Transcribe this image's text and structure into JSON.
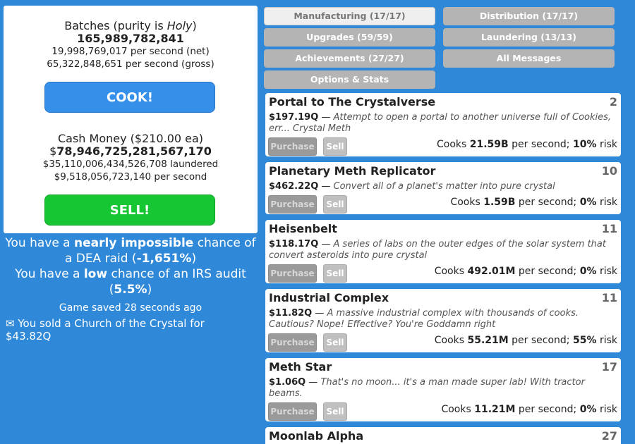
{
  "stats": {
    "batches_title_prefix": "Batches (purity is ",
    "batches_purity": "Holy",
    "batches_title_suffix": ")",
    "batches_value": "165,989,782,841",
    "batches_net": "19,998,769,017 per second (net)",
    "batches_gross": "65,322,848,651 per second (gross)",
    "cook_label": "COOK!",
    "cash_title": "Cash Money ($210.00 ea)",
    "cash_symbol": "$",
    "cash_value": "78,946,725,281,567,170",
    "cash_laundered": "$35,110,006,434,526,708 laundered",
    "cash_rate": "$9,518,056,723,140 per second",
    "sell_label": "SELL!"
  },
  "risk": {
    "dea_prefix": "You have a ",
    "dea_level": "nearly impossible",
    "dea_mid": " chance of a DEA raid (",
    "dea_value": "-1,651%",
    "dea_suffix": ")",
    "irs_prefix": "You have a ",
    "irs_level": "low",
    "irs_mid": " chance of an IRS audit (",
    "irs_value": "5.5%",
    "irs_suffix": ")"
  },
  "saved": "Game saved 28 seconds ago",
  "message": {
    "icon": "envelope-icon",
    "glyph": "✉",
    "text": "You sold a Church of the Crystal for $43.82Q"
  },
  "tabs": {
    "manufacturing": "Manufacturing (17/17)",
    "distribution": "Distribution (17/17)",
    "upgrades": "Upgrades (59/59)",
    "laundering": "Laundering (13/13)",
    "achievements": "Achievements (27/27)",
    "messages": "All Messages",
    "options": "Options & Stats"
  },
  "products": [
    {
      "name": "Portal to The Crystalverse",
      "count": "2",
      "price": "$197.19Q",
      "desc": "Attempt to open a portal to another universe full of Cookies, err... Crystal Meth",
      "purchase": "Purchase",
      "sell": "Sell",
      "rate_prefix": "Cooks ",
      "rate": "21.59B",
      "rate_mid": " per second; ",
      "risk": "10%",
      "risk_suffix": " risk"
    },
    {
      "name": "Planetary Meth Replicator",
      "count": "10",
      "price": "$462.22Q",
      "desc": "Convert all of a planet's matter into pure crystal",
      "purchase": "Purchase",
      "sell": "Sell",
      "rate_prefix": "Cooks ",
      "rate": "1.59B",
      "rate_mid": " per second; ",
      "risk": "0%",
      "risk_suffix": " risk"
    },
    {
      "name": "Heisenbelt",
      "count": "11",
      "price": "$118.17Q",
      "desc": "A series of labs on the outer edges of the solar system that convert asteroids into pure crystal",
      "purchase": "Purchase",
      "sell": "Sell",
      "rate_prefix": "Cooks ",
      "rate": "492.01M",
      "rate_mid": " per second; ",
      "risk": "0%",
      "risk_suffix": " risk"
    },
    {
      "name": "Industrial Complex",
      "count": "11",
      "price": "$11.82Q",
      "desc": "A massive industrial complex with thousands of cooks. Cautious? Nope! Effective? You're Goddamn right",
      "purchase": "Purchase",
      "sell": "Sell",
      "rate_prefix": "Cooks ",
      "rate": "55.21M",
      "rate_mid": " per second; ",
      "risk": "55%",
      "risk_suffix": " risk"
    },
    {
      "name": "Meth Star",
      "count": "17",
      "price": "$1.06Q",
      "desc": "That's no moon... it's a man made super lab! With tractor beams.",
      "purchase": "Purchase",
      "sell": "Sell",
      "rate_prefix": "Cooks ",
      "rate": "11.21M",
      "rate_mid": " per second; ",
      "risk": "0%",
      "risk_suffix": " risk"
    },
    {
      "name": "Moonlab Alpha",
      "count": "27"
    }
  ]
}
